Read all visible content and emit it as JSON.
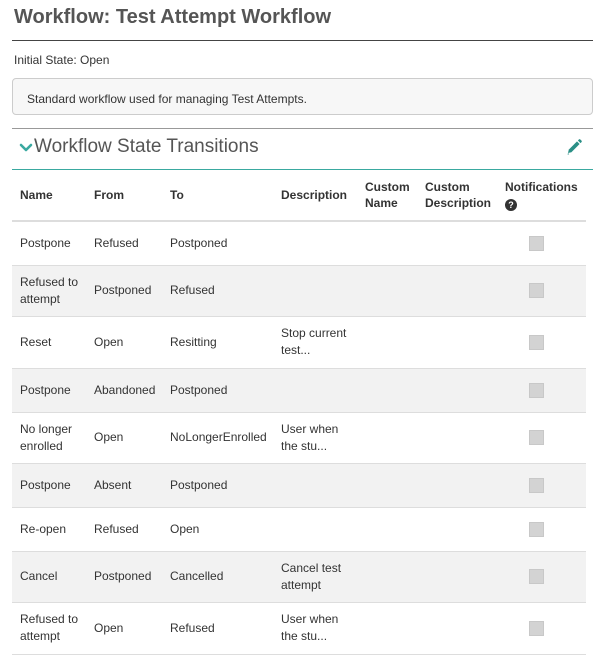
{
  "header": {
    "title": "Workflow: Test Attempt Workflow"
  },
  "initial_state": "Initial State: Open",
  "description": "Standard workflow used for managing Test Attempts.",
  "section": {
    "title": "Workflow State Transitions",
    "icons": {
      "collapse": "chevron-down-icon",
      "edit": "pencil-icon"
    },
    "accent_color": "#3aa9a0"
  },
  "table": {
    "headers": {
      "name": "Name",
      "from": "From",
      "to": "To",
      "description": "Description",
      "custom_name": "Custom Name",
      "custom_description": "Custom Description",
      "notifications": "Notifications"
    },
    "rows": [
      {
        "name": "Postpone",
        "from": "Refused",
        "to": "Postponed",
        "description": "",
        "custom_name": "",
        "custom_description": "",
        "notifications": false
      },
      {
        "name": "Refused to attempt",
        "from": "Postponed",
        "to": "Refused",
        "description": "",
        "custom_name": "",
        "custom_description": "",
        "notifications": false
      },
      {
        "name": "Reset",
        "from": "Open",
        "to": "Resitting",
        "description": "Stop current test...",
        "custom_name": "",
        "custom_description": "",
        "notifications": false
      },
      {
        "name": "Postpone",
        "from": "Abandoned",
        "to": "Postponed",
        "description": "",
        "custom_name": "",
        "custom_description": "",
        "notifications": false
      },
      {
        "name": "No longer enrolled",
        "from": "Open",
        "to": "NoLongerEnrolled",
        "description": "User when the stu...",
        "custom_name": "",
        "custom_description": "",
        "notifications": false
      },
      {
        "name": "Postpone",
        "from": "Absent",
        "to": "Postponed",
        "description": "",
        "custom_name": "",
        "custom_description": "",
        "notifications": false
      },
      {
        "name": "Re-open",
        "from": "Refused",
        "to": "Open",
        "description": "",
        "custom_name": "",
        "custom_description": "",
        "notifications": false
      },
      {
        "name": "Cancel",
        "from": "Postponed",
        "to": "Cancelled",
        "description": "Cancel test attempt",
        "custom_name": "",
        "custom_description": "",
        "notifications": false
      },
      {
        "name": "Refused to attempt",
        "from": "Open",
        "to": "Refused",
        "description": "User when the stu...",
        "custom_name": "",
        "custom_description": "",
        "notifications": false
      }
    ]
  }
}
